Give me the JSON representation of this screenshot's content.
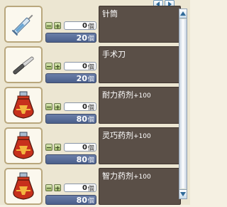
{
  "colors": {
    "description_bg": "#5a4f47",
    "price_bg": "#4a5f8b",
    "slot_border": "#b9a77d",
    "panel_bg": "#ece6d2"
  },
  "pager": {
    "prev_icon": "arrow-left-icon",
    "next_icon": "arrow-right-icon"
  },
  "items": [
    {
      "name": "针筒",
      "bonus": "",
      "count": "0",
      "count_unit": "個",
      "price": "20",
      "price_unit": "個",
      "icon": "syringe-icon"
    },
    {
      "name": "手术刀",
      "bonus": "",
      "count": "0",
      "count_unit": "個",
      "price": "20",
      "price_unit": "個",
      "icon": "scalpel-icon"
    },
    {
      "name": "耐力药剂",
      "bonus": "+100",
      "count": "0",
      "count_unit": "個",
      "price": "80",
      "price_unit": "個",
      "icon": "potion-icon"
    },
    {
      "name": "灵巧药剂",
      "bonus": "+100",
      "count": "0",
      "count_unit": "個",
      "price": "80",
      "price_unit": "個",
      "icon": "potion-icon"
    },
    {
      "name": "智力药剂",
      "bonus": "+100",
      "count": "0",
      "count_unit": "個",
      "price": "80",
      "price_unit": "個",
      "icon": "potion-icon"
    }
  ]
}
